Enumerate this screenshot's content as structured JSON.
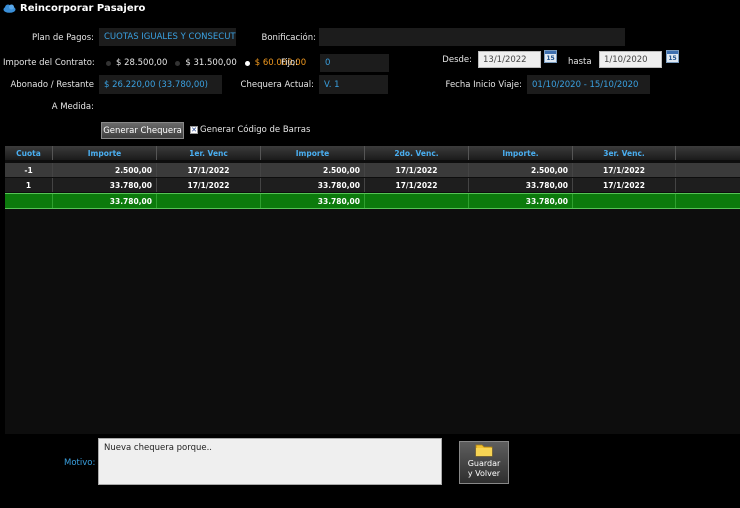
{
  "window": {
    "title": "Reincorporar Pasajero",
    "icon": "cloud-icon"
  },
  "form": {
    "plan_label": "Plan de Pagos:",
    "plan_value": "CUOTAS IGUALES Y CONSECUT",
    "bonificacion_label": "Bonificación:",
    "bonificacion_value": "",
    "importe_label": "Importe del Contrato:",
    "importe_options": [
      "$ 28.500,00",
      "$ 31.500,00",
      "$ 60.000,00"
    ],
    "importe_selected": "$ 60.000,00",
    "fijo_label": "Fijo:",
    "fijo_value": "0",
    "desde_label": "Desde:",
    "desde_value": "13/1/2022",
    "hasta_label": "hasta",
    "hasta_value": "1/10/2020",
    "calendar_icon_text": "15",
    "abonado_label": "Abonado / Restante",
    "abonado_value": "$ 26.220,00 (33.780,00)",
    "chequera_label": "Chequera Actual:",
    "chequera_value": "V. 1",
    "fecha_label": "Fecha Inicio Viaje:",
    "fecha_value": "01/10/2020 - 15/10/2020",
    "medida_label": "A Medida:",
    "generar_button": "Generar Chequera",
    "barcode_check_label": "Generar Código de Barras",
    "barcode_checked": true
  },
  "table": {
    "headers": [
      "Cuota",
      "Importe",
      "1er. Venc",
      "Importe",
      "2do. Venc.",
      "Importe.",
      "3er. Venc."
    ],
    "rows": [
      [
        "-1",
        "2.500,00",
        "17/1/2022",
        "2.500,00",
        "17/1/2022",
        "2.500,00",
        "17/1/2022"
      ],
      [
        "1",
        "33.780,00",
        "17/1/2022",
        "33.780,00",
        "17/1/2022",
        "33.780,00",
        "17/1/2022"
      ]
    ],
    "totals": [
      "",
      "33.780,00",
      "",
      "33.780,00",
      "",
      "33.780,00",
      ""
    ]
  },
  "footer": {
    "motivo_label": "Motivo:",
    "motivo_value": "Nueva chequera porque..",
    "save_line1": "Guardar",
    "save_line2": "y Volver"
  },
  "colors": {
    "accent": "#3aa0e0",
    "orange": "#f29a1f",
    "total_green": "#0c7a0c"
  }
}
